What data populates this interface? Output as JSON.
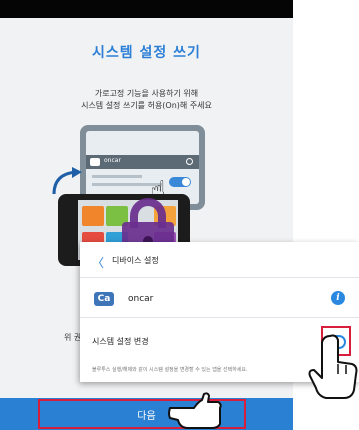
{
  "screen": {
    "title": "시스템 설정 쓰기",
    "description_line1": "가로고정 기능을 사용하기 위해",
    "description_line2": "시스템 설정 쓰기를 허용(On)해 주세요",
    "illustration_app_name": "oncar",
    "left_partial_text": "위 권",
    "next_button_label": "다음"
  },
  "settings_card": {
    "header_title": "디바이스 설정",
    "app_logo_text": "Ca",
    "app_name": "oncar",
    "info_symbol": "i",
    "setting_label": "시스템 설정 변경",
    "setting_toggle_state": "on",
    "setting_description": "블루투스 실행/해제와 같이 시스템 설정을 변경할 수 있는 앱을 선택하세요."
  },
  "colors": {
    "accent_blue": "#2b7fd6",
    "highlight_red": "#d81e3a",
    "lock_purple": "#6a2f8f",
    "background": "#f1f2f4"
  }
}
